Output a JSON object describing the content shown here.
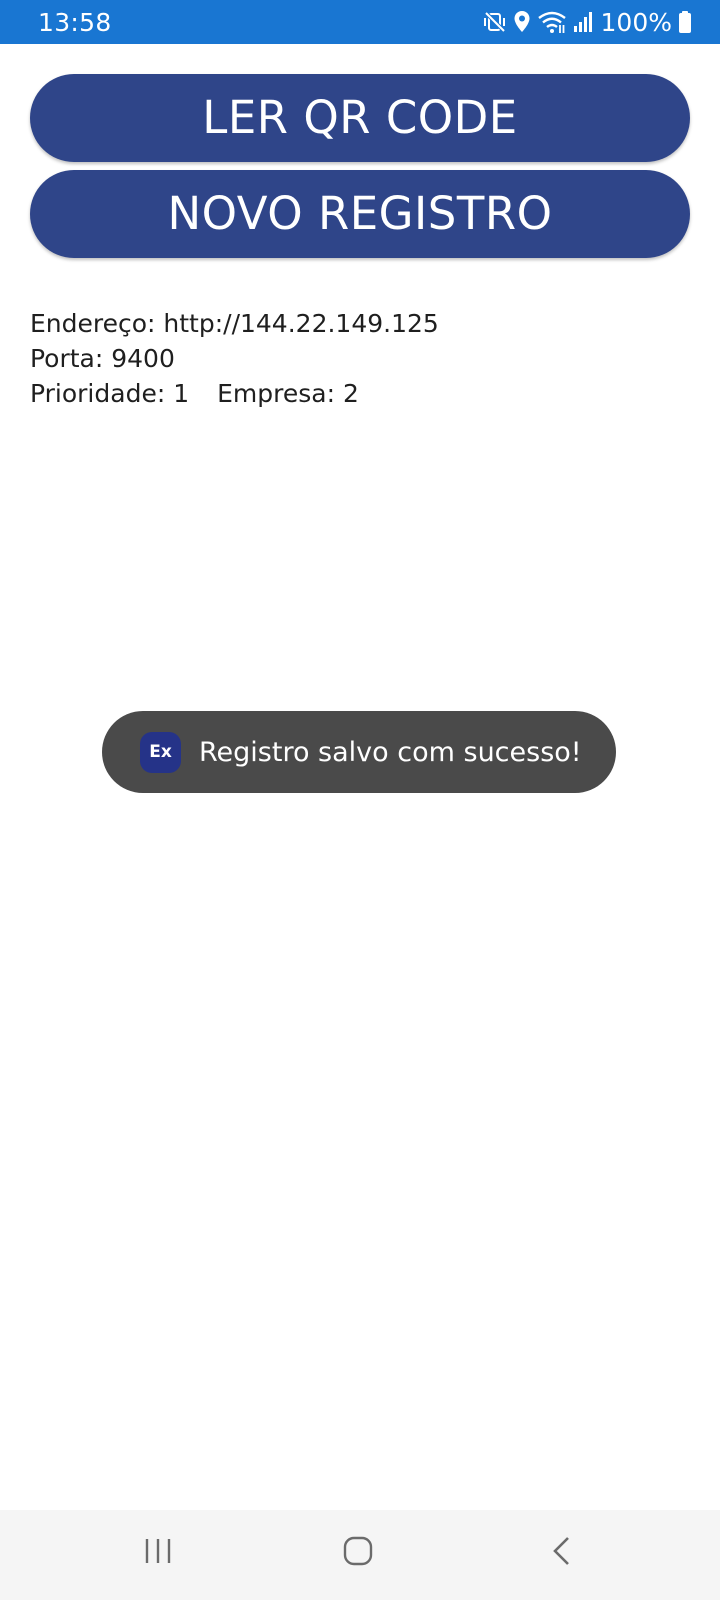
{
  "status_bar": {
    "time": "13:58",
    "battery": "100%",
    "icons": [
      "mute-vibrate-icon",
      "location-icon",
      "wifi-icon",
      "signal-icon",
      "battery-icon"
    ],
    "background": "#1976d2"
  },
  "buttons": {
    "read_qr_label": "LER QR CODE",
    "new_record_label": "NOVO REGISTRO",
    "color": "#2f4589"
  },
  "info": {
    "address": "Endereço: http://144.22.149.125",
    "port": "Porta: 9400",
    "priority": "Prioridade: 1",
    "company": "Empresa: 2"
  },
  "toast": {
    "app_icon_text": "Ex",
    "message": "Registro salvo com sucesso!"
  },
  "nav_bar": {
    "icons": [
      "recents-icon",
      "home-icon",
      "back-icon"
    ]
  }
}
